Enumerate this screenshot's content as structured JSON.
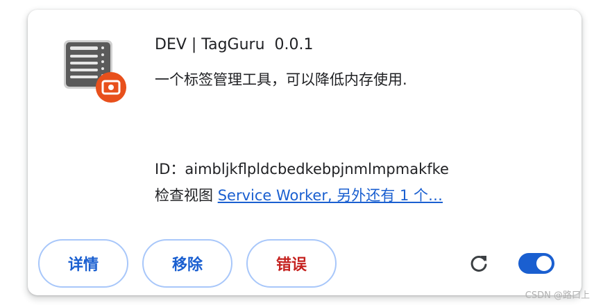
{
  "extension": {
    "name": "DEV | TagGuru",
    "version": "0.0.1",
    "description": "一个标签管理工具，可以降低内存使用.",
    "id_label": "ID：",
    "id_value": "aimbljkflpldcbedkebpjnmlmpmakfke",
    "inspect_label": "检查视图",
    "inspect_link": "Service Worker, 另外还有 1 个…",
    "icon": "list-server-icon",
    "badge_icon": "dev-camera-badge-icon",
    "enabled": true
  },
  "actions": {
    "details_label": "详情",
    "remove_label": "移除",
    "errors_label": "错误",
    "reload_icon": "reload-icon",
    "toggle_icon": "toggle-switch"
  },
  "colors": {
    "accent": "#1a5fd0",
    "error": "#c5221f",
    "button_border": "#a8c7fa",
    "badge": "#e8501c"
  },
  "watermark": "CSDN @路口上"
}
